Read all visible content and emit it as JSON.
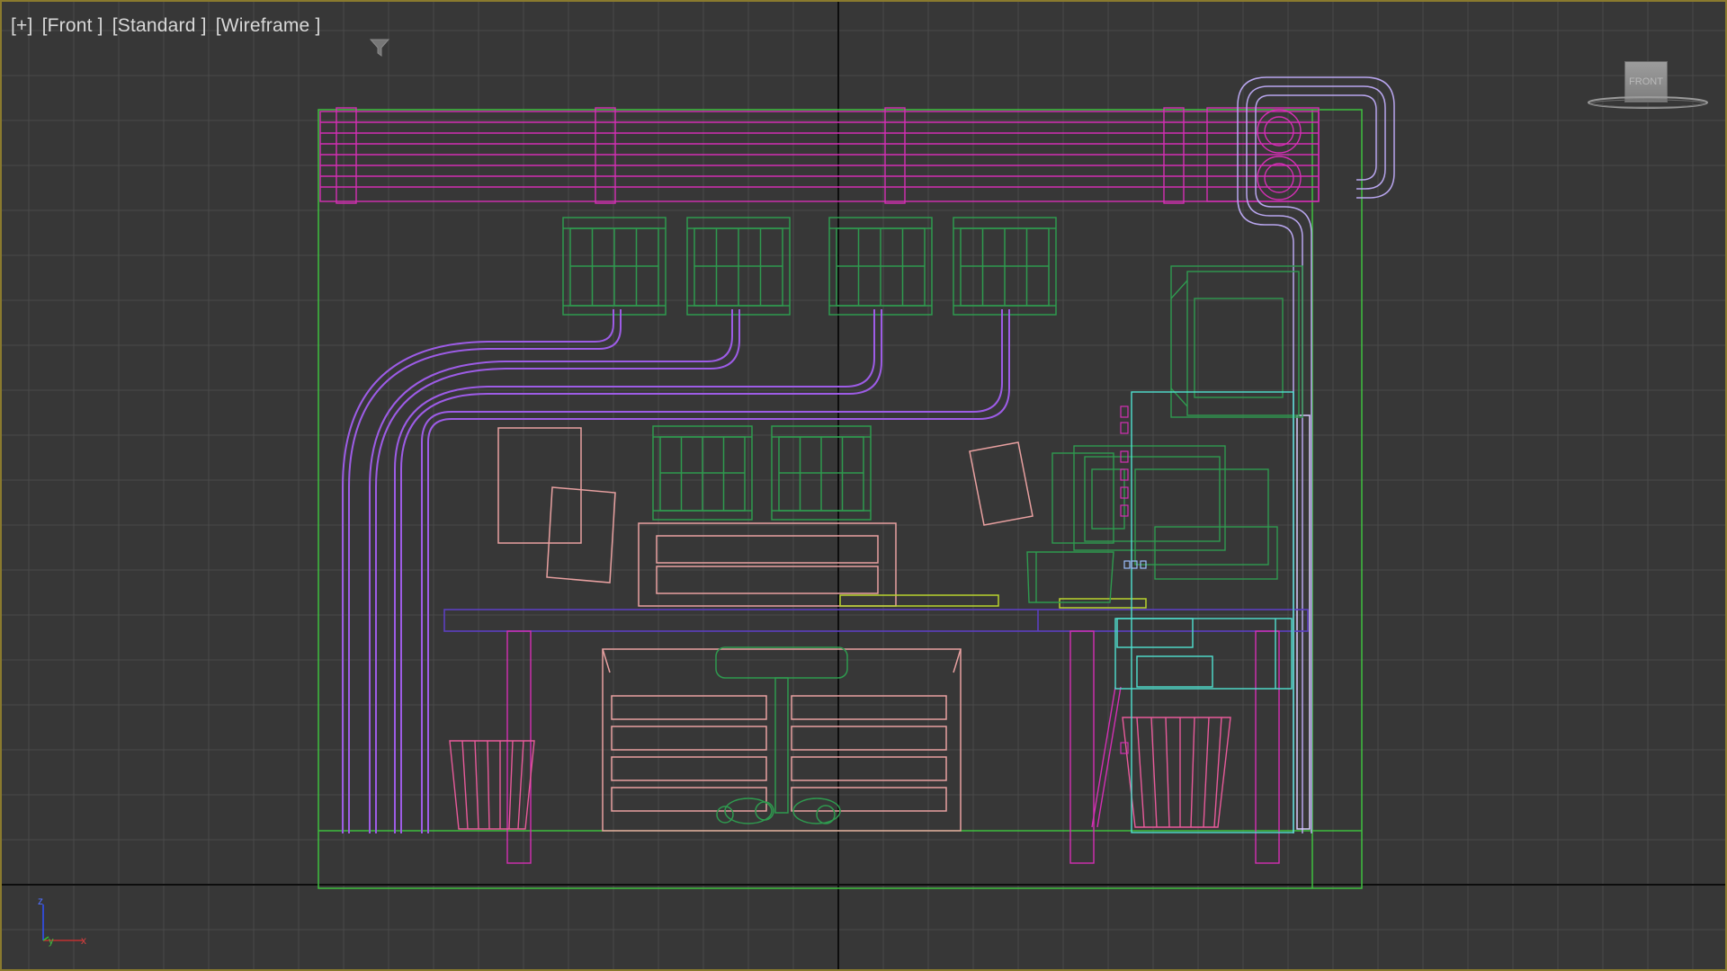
{
  "viewport": {
    "label_plus": "[+]",
    "label_view": "[Front ]",
    "label_shading_style": "[Standard ]",
    "label_shading": "[Wireframe ]",
    "filter_icon": "funnel-icon"
  },
  "viewcube": {
    "face_label": "FRONT"
  },
  "axis_gizmo": {
    "z_label": "z",
    "y_label": "y",
    "x_label": "x"
  },
  "colors": {
    "viewport_bg": "#373737",
    "active_border": "#8a7a2e",
    "grid_line": "#4a4a4a",
    "grid_axis": "#0b0b0b",
    "room_green": "#3fbf3f",
    "pipe_purple": "#9d5ce6",
    "rail_magenta": "#d42fb4",
    "furniture_pink": "#e8a0a0",
    "plant_green": "#2f9a4f",
    "desk_violet": "#5b3fc0",
    "cyan": "#4fe0d0",
    "keyboard_yellow": "#b8d42f",
    "wastebin_pink": "#e85a9a"
  }
}
